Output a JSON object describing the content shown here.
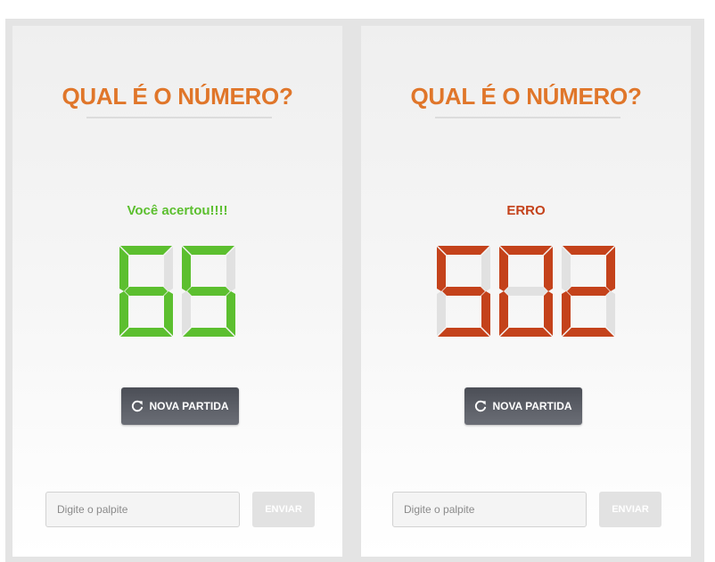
{
  "colors": {
    "title": "#e0762a",
    "success": "#5cbf2f",
    "error": "#c4421b",
    "segment_off": "#e1e1e1"
  },
  "panels": [
    {
      "title": "QUAL É O NÚMERO?",
      "status": "Você acertou!!!!",
      "status_type": "success",
      "display_value": "65",
      "new_game_label": "NOVA PARTIDA",
      "new_game_icon": "refresh-icon",
      "guess_placeholder": "Digite o palpite",
      "guess_value": "",
      "send_label": "ENVIAR"
    },
    {
      "title": "QUAL É O NÚMERO?",
      "status": "ERRO",
      "status_type": "error",
      "display_value": "502",
      "new_game_label": "NOVA PARTIDA",
      "new_game_icon": "refresh-icon",
      "guess_placeholder": "Digite o palpite",
      "guess_value": "",
      "send_label": "ENVIAR"
    }
  ]
}
